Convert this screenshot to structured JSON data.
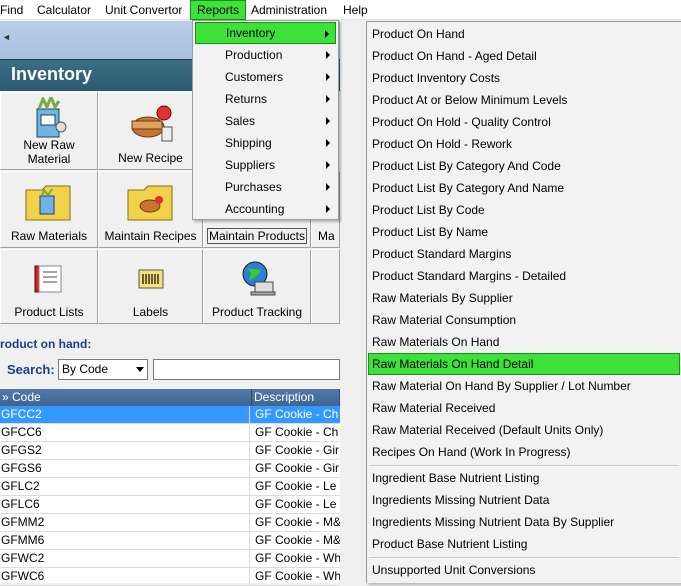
{
  "menubar": {
    "items": [
      "Find",
      "Calculator",
      "Unit Convertor",
      "Reports",
      "Administration",
      "Help"
    ]
  },
  "section": {
    "title": "Inventory"
  },
  "tiles": [
    {
      "label": "New Raw\nMaterial"
    },
    {
      "label": "New Recipe"
    },
    {
      "label": "Raw Materials"
    },
    {
      "label": "Maintain Recipes"
    },
    {
      "label": "Maintain Products"
    },
    {
      "label": "Ma"
    },
    {
      "label": "Product Lists"
    },
    {
      "label": "Labels"
    },
    {
      "label": "Product Tracking"
    }
  ],
  "product_on_hand": {
    "title": "roduct on hand:",
    "search_label": "Search:",
    "search_by": "By Code",
    "search_value": ""
  },
  "table": {
    "columns": [
      "» Code",
      "Description"
    ],
    "rows": [
      {
        "code": "GFCC2",
        "desc": "GF Cookie - Ch"
      },
      {
        "code": "GFCC6",
        "desc": "GF Cookie - Ch"
      },
      {
        "code": "GFGS2",
        "desc": "GF Cookie - Gir"
      },
      {
        "code": "GFGS6",
        "desc": "GF Cookie - Gir"
      },
      {
        "code": "GFLC2",
        "desc": "GF Cookie - Le"
      },
      {
        "code": "GFLC6",
        "desc": "GF Cookie - Le"
      },
      {
        "code": "GFMM2",
        "desc": "GF Cookie - M&"
      },
      {
        "code": "GFMM6",
        "desc": "GF Cookie - M&"
      },
      {
        "code": "GFWC2",
        "desc": "GF Cookie - Wh"
      },
      {
        "code": "GFWC6",
        "desc": "GF Cookie - Wh"
      }
    ]
  },
  "reports_menu": {
    "items": [
      "Inventory",
      "Production",
      "Customers",
      "Returns",
      "Sales",
      "Shipping",
      "Suppliers",
      "Purchases",
      "Accounting"
    ]
  },
  "inventory_submenu": {
    "items": [
      "Product On Hand",
      "Product On Hand - Aged Detail",
      "Product Inventory Costs",
      "Product At or Below Minimum Levels",
      "Product On Hold - Quality Control",
      "Product On Hold - Rework",
      "Product List By Category And Code",
      "Product List By Category And Name",
      "Product List By Code",
      "Product List By Name",
      "Product Standard Margins",
      "Product Standard Margins - Detailed",
      "Raw Materials By Supplier",
      "Raw Material Consumption",
      "Raw Materials On Hand",
      "Raw Materials On Hand Detail",
      "Raw Material On Hand By Supplier / Lot Number",
      "Raw Material Received",
      "Raw Material Received (Default Units Only)",
      "Recipes On Hand (Work In Progress)",
      "Ingredient Base Nutrient Listing",
      "Ingredients Missing Nutrient Data",
      "Ingredients Missing Nutrient Data By Supplier",
      "Product Base Nutrient Listing",
      "Unsupported Unit Conversions"
    ]
  },
  "colors": {
    "highlight": "#3ee13a",
    "section_header": "#2b5a72",
    "selection": "#3399ff",
    "label_blue": "#1b3d8f"
  }
}
